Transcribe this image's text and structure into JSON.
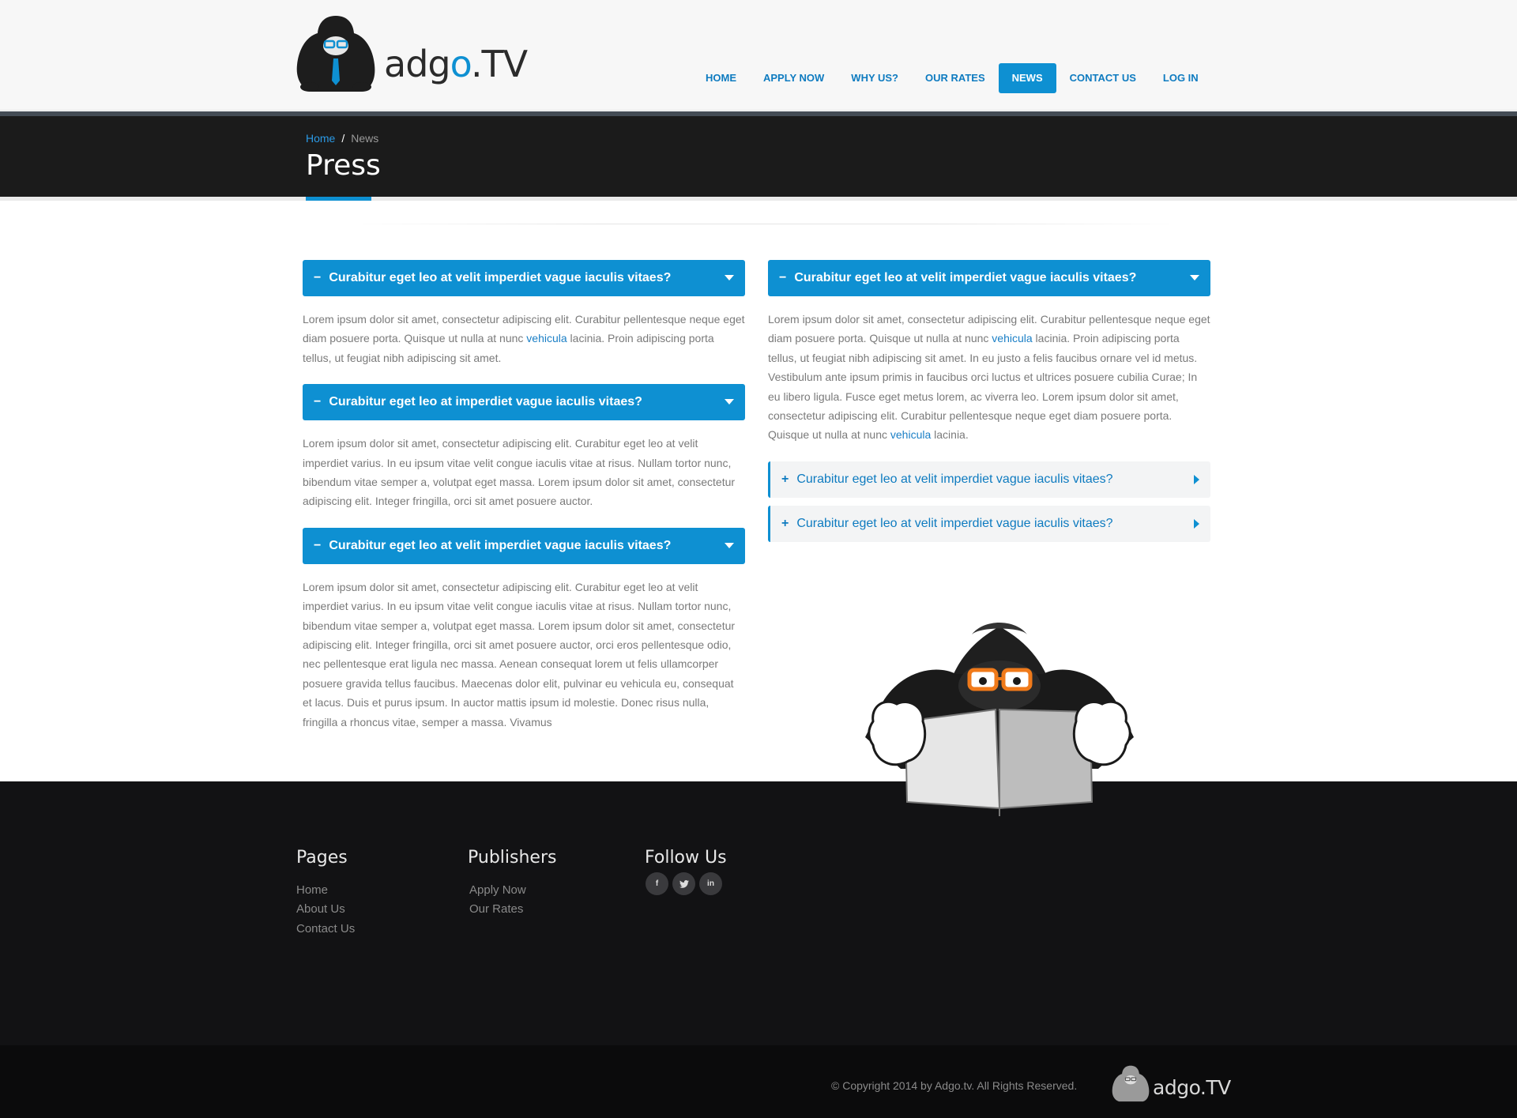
{
  "brand": {
    "name_prefix": "adg",
    "name_o": "o",
    "name_suffix": ".TV"
  },
  "nav": {
    "items": [
      {
        "label": "HOME"
      },
      {
        "label": "APPLY NOW"
      },
      {
        "label": "WHY US?"
      },
      {
        "label": "OUR RATES"
      },
      {
        "label": "NEWS",
        "active": true
      },
      {
        "label": "CONTACT US"
      },
      {
        "label": "LOG IN"
      }
    ]
  },
  "breadcrumb": {
    "home": "Home",
    "separator": "/",
    "current": "News"
  },
  "page_title": "Press",
  "left_column": [
    {
      "sign": "−",
      "title": "Curabitur eget leo at velit imperdiet vague iaculis vitaes?",
      "expanded": true,
      "body_before": "Lorem ipsum dolor sit amet, consectetur adipiscing elit. Curabitur pellentesque neque eget diam posuere porta. Quisque ut nulla at nunc ",
      "link": "vehicula",
      "body_after": " lacinia. Proin adipiscing porta tellus, ut feugiat nibh adipiscing sit amet."
    },
    {
      "sign": "−",
      "title": "Curabitur eget leo at imperdiet vague iaculis vitaes?",
      "expanded": true,
      "body": "Lorem ipsum dolor sit amet, consectetur adipiscing elit. Curabitur eget leo at velit imperdiet varius. In eu ipsum vitae velit congue iaculis vitae at risus. Nullam tortor nunc, bibendum vitae semper a, volutpat eget massa. Lorem ipsum dolor sit amet, consectetur adipiscing elit. Integer fringilla, orci sit amet posuere auctor."
    },
    {
      "sign": "−",
      "title": "Curabitur eget leo at velit imperdiet vague iaculis vitaes?",
      "expanded": true,
      "body": "Lorem ipsum dolor sit amet, consectetur adipiscing elit. Curabitur eget leo at velit imperdiet varius. In eu ipsum vitae velit congue iaculis vitae at risus. Nullam tortor nunc, bibendum vitae semper a, volutpat eget massa. Lorem ipsum dolor sit amet, consectetur adipiscing elit. Integer fringilla, orci sit amet posuere auctor, orci eros pellentesque odio, nec pellentesque erat ligula nec massa. Aenean consequat lorem ut felis ullamcorper posuere gravida tellus faucibus. Maecenas dolor elit, pulvinar eu vehicula eu, consequat et lacus. Duis et purus ipsum. In auctor mattis ipsum id molestie. Donec risus nulla, fringilla a rhoncus vitae, semper a massa. Vivamus"
    }
  ],
  "right_column": [
    {
      "sign": "−",
      "title": "Curabitur eget leo at velit imperdiet vague iaculis vitaes?",
      "expanded": true,
      "body_1": "Lorem ipsum dolor sit amet, consectetur adipiscing elit. Curabitur pellentesque neque eget diam posuere porta. Quisque ut nulla at nunc ",
      "link_1": "vehicula",
      "body_2": " lacinia. Proin adipiscing porta tellus, ut feugiat nibh adipiscing sit amet. In eu justo a felis faucibus ornare vel id metus. Vestibulum ante ipsum primis in faucibus orci luctus et ultrices posuere cubilia Curae; In eu libero ligula. Fusce eget metus lorem, ac viverra leo. Lorem ipsum dolor sit amet, consectetur adipiscing elit. Curabitur pellentesque neque eget diam posuere porta. Quisque ut nulla at nunc ",
      "link_2": "vehicula",
      "body_3": " lacinia."
    },
    {
      "sign": "+",
      "title": "Curabitur eget leo at velit imperdiet vague iaculis vitaes?",
      "expanded": false
    },
    {
      "sign": "+",
      "title": "Curabitur eget leo at velit imperdiet vague iaculis vitaes?",
      "expanded": false
    }
  ],
  "footer": {
    "pages": {
      "heading": "Pages",
      "links": [
        "Home",
        "About Us",
        "Contact Us"
      ]
    },
    "publishers": {
      "heading": "Publishers",
      "links": [
        "Apply Now",
        "Our Rates"
      ]
    },
    "follow": {
      "heading": "Follow Us",
      "icons": [
        {
          "name": "facebook-icon",
          "glyph": "f"
        },
        {
          "name": "twitter-icon",
          "glyph": "t"
        },
        {
          "name": "linkedin-icon",
          "glyph": "in"
        }
      ]
    }
  },
  "copyright": "© Copyright 2014 by Adgo.tv.  All Rights Reserved.",
  "colors": {
    "accent": "#0e90d2",
    "dark": "#1b1b1b",
    "footer": "#121214"
  }
}
